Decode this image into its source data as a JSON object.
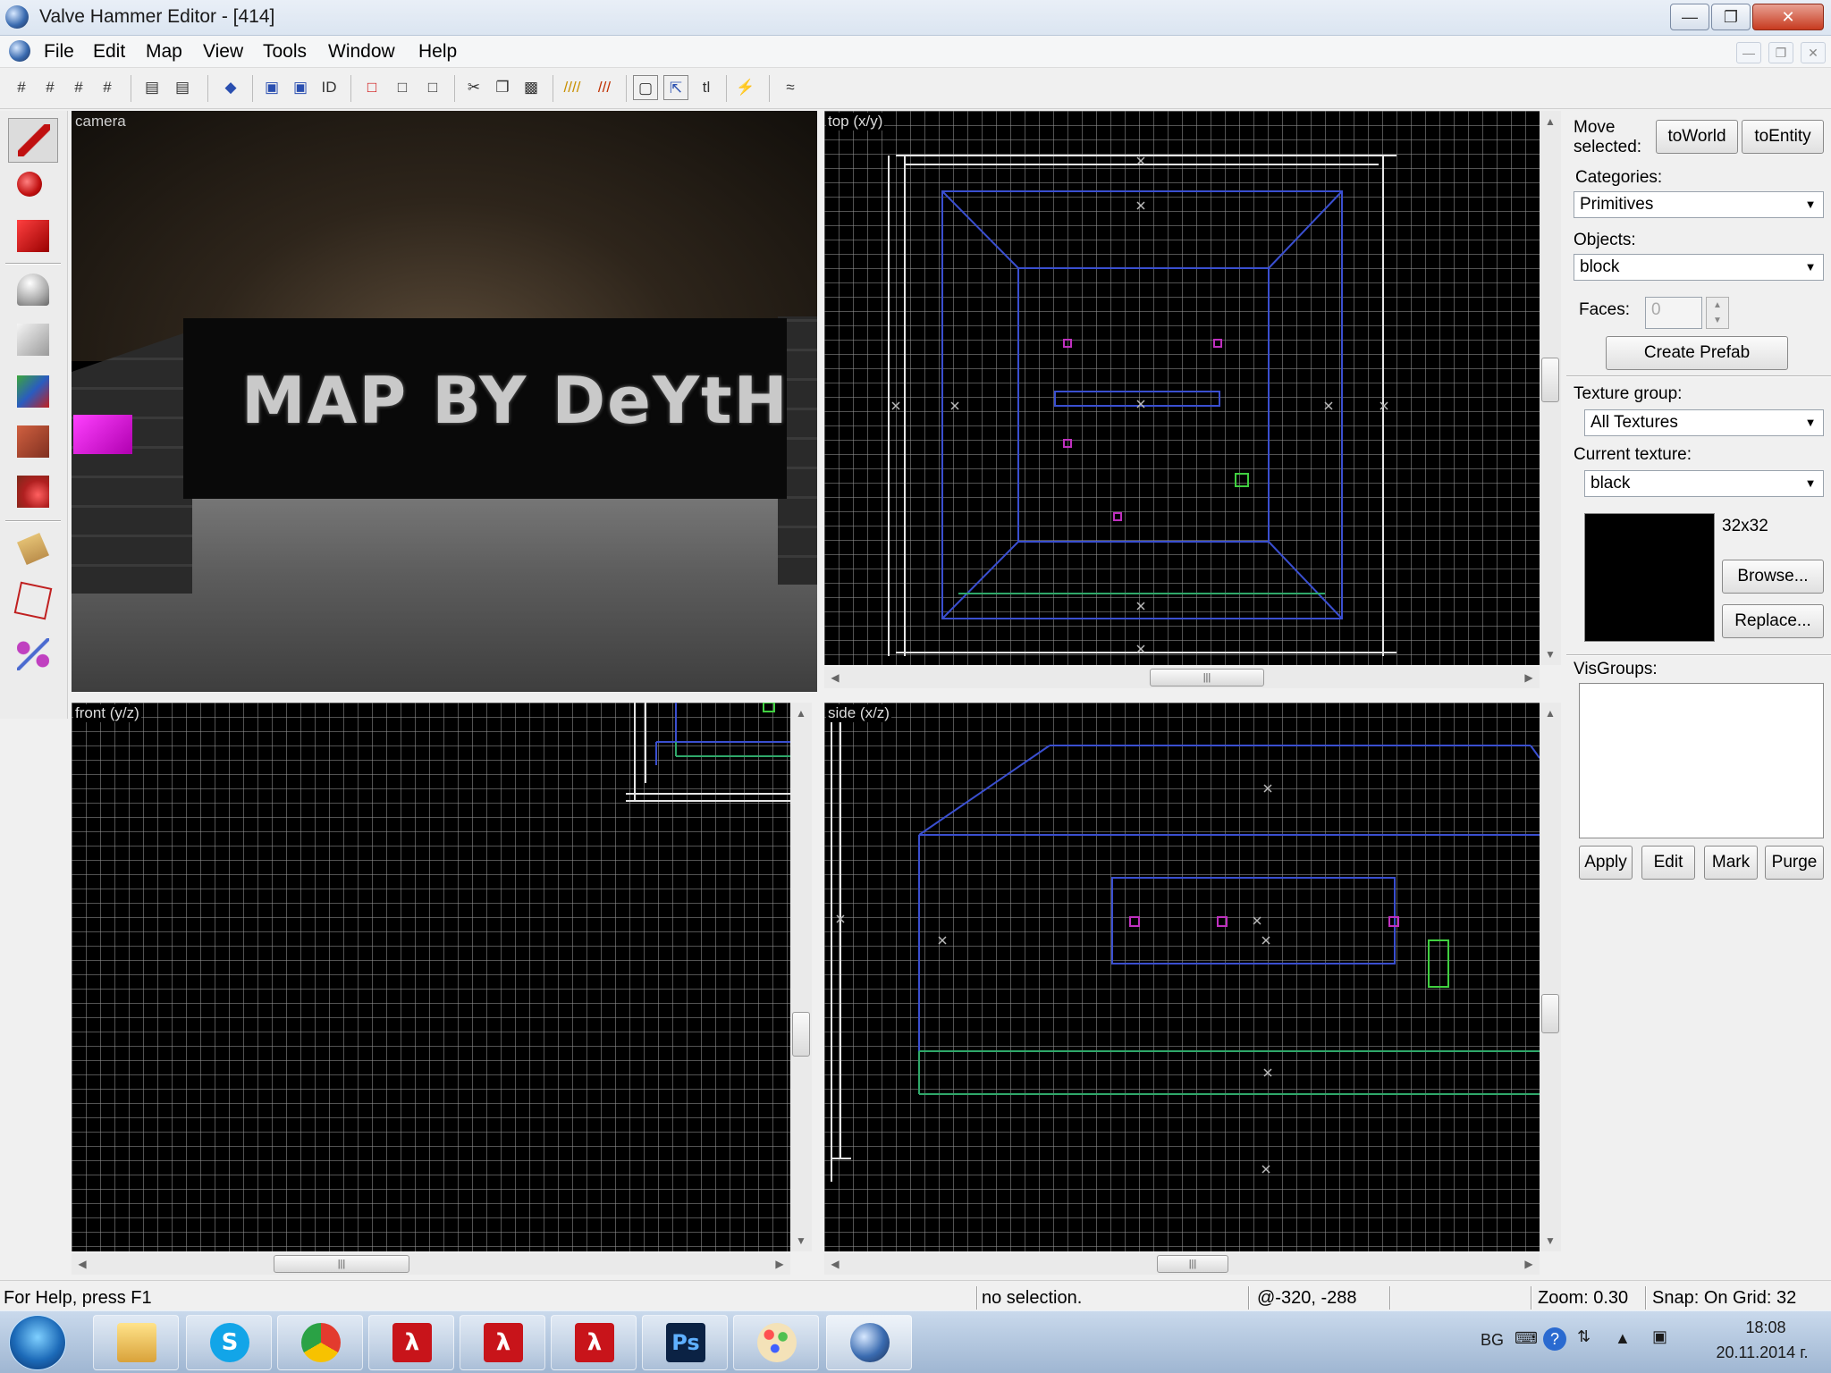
{
  "window": {
    "title": "Valve Hammer Editor - [414]"
  },
  "menu": {
    "items": [
      "File",
      "Edit",
      "Map",
      "View",
      "Tools",
      "Window",
      "Help"
    ]
  },
  "viewports": {
    "camera": {
      "label": "camera",
      "texture_text": "MAP BY DeYtH"
    },
    "top": {
      "label": "top (x/y)"
    },
    "front": {
      "label": "front (y/z)"
    },
    "side": {
      "label": "side (x/z)"
    }
  },
  "panel": {
    "move_selected_label": "Move selected:",
    "to_world": "toWorld",
    "to_entity": "toEntity",
    "categories_label": "Categories:",
    "categories_value": "Primitives",
    "objects_label": "Objects:",
    "objects_value": "block",
    "faces_label": "Faces:",
    "faces_value": "0",
    "create_prefab": "Create Prefab",
    "texture_group_label": "Texture group:",
    "texture_group_value": "All Textures",
    "current_texture_label": "Current texture:",
    "current_texture_value": "black",
    "texture_size": "32x32",
    "browse": "Browse...",
    "replace": "Replace...",
    "visgroups_label": "VisGroups:",
    "apply": "Apply",
    "edit": "Edit",
    "mark": "Mark",
    "purge": "Purge"
  },
  "status": {
    "help": "For Help, press F1",
    "selection": "no selection.",
    "coords": "@-320, -288",
    "zoom": "Zoom: 0.30",
    "snap": "Snap: On Grid: 32"
  },
  "taskbar": {
    "lang": "BG",
    "time": "18:08",
    "date": "20.11.2014 г."
  },
  "colors": {
    "brush_blue": "#3a4fd0",
    "brush_green": "#2fa86a",
    "entity_magenta": "#c030c0",
    "grid": "#969696",
    "bounds_white": "#e0e0e0"
  }
}
